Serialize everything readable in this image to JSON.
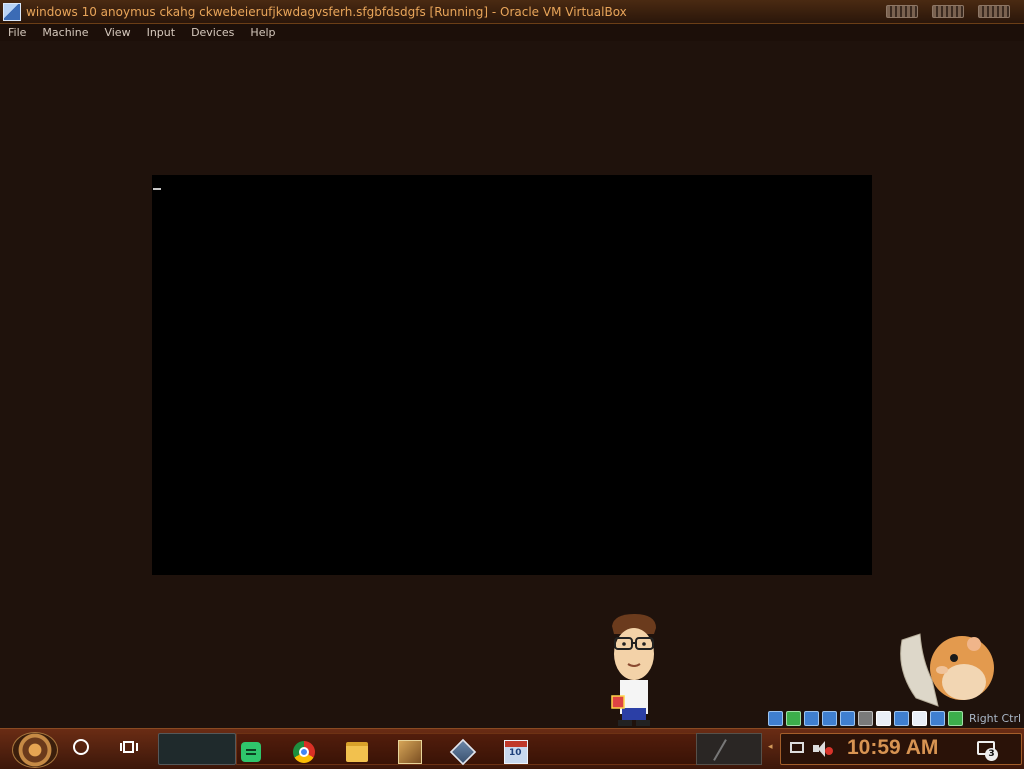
{
  "window": {
    "title": "windows 10 anoymus ckahg ckwebeierufjkwdagvsferh.sfgbfdsdgfs [Running] - Oracle VM VirtualBox"
  },
  "menu": {
    "items": [
      "File",
      "Machine",
      "View",
      "Input",
      "Devices",
      "Help"
    ]
  },
  "vm_status": {
    "host_key_label": "Right Ctrl"
  },
  "taskbar": {
    "pinned_icons": [
      "notes-icon",
      "chrome-icon",
      "file-explorer-icon",
      "box-app-icon",
      "virtualbox-icon",
      "calendar-icon"
    ],
    "clock": "10:59 AM",
    "notification_count": "3"
  },
  "colors": {
    "title_text": "#e8a55a",
    "clock_text": "#d89452",
    "desktop_bg": "#1f120c"
  }
}
